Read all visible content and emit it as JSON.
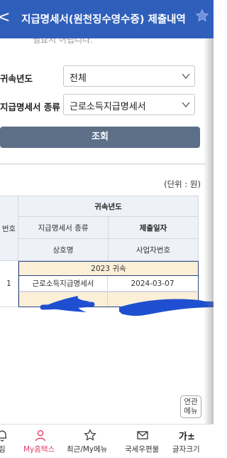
{
  "header": {
    "title": "지급명세서(원천징수영수증) 제출내역",
    "back_glyph": "<",
    "bg_color": "#2f5fbb"
  },
  "faded_text": "필요서 어립니다.",
  "form": {
    "year_label": "귀속년도",
    "year_value": "전체",
    "type_label": "지급명세서 종류",
    "type_value": "근로소득지급명세서",
    "search_button": "조회"
  },
  "unit": "(단위 : 원)",
  "table": {
    "col_no": "번호",
    "group_header": "귀속년도",
    "headers": {
      "type": "지급명세서 종류",
      "date": "제출일자",
      "company": "상호명",
      "bizno": "사업자번호"
    },
    "year_row": "2023 귀속",
    "rows": [
      {
        "no": "1",
        "type": "근로소득지급명세서",
        "date": "2024-03-07"
      }
    ]
  },
  "related_menu": "연관\n메뉴",
  "related_menu_line1": "연관",
  "related_menu_line2": "메뉴",
  "bottom_nav": [
    {
      "label": "림",
      "icon": "bell-icon"
    },
    {
      "label": "My홈택스",
      "icon": "person-icon",
      "color": "#e0406a"
    },
    {
      "label": "최근/My메뉴",
      "icon": "star-icon"
    },
    {
      "label": "국세우편물",
      "icon": "envelope-icon"
    },
    {
      "label": "글자크기",
      "icon": "text-size-icon",
      "glyph": "가±"
    }
  ]
}
